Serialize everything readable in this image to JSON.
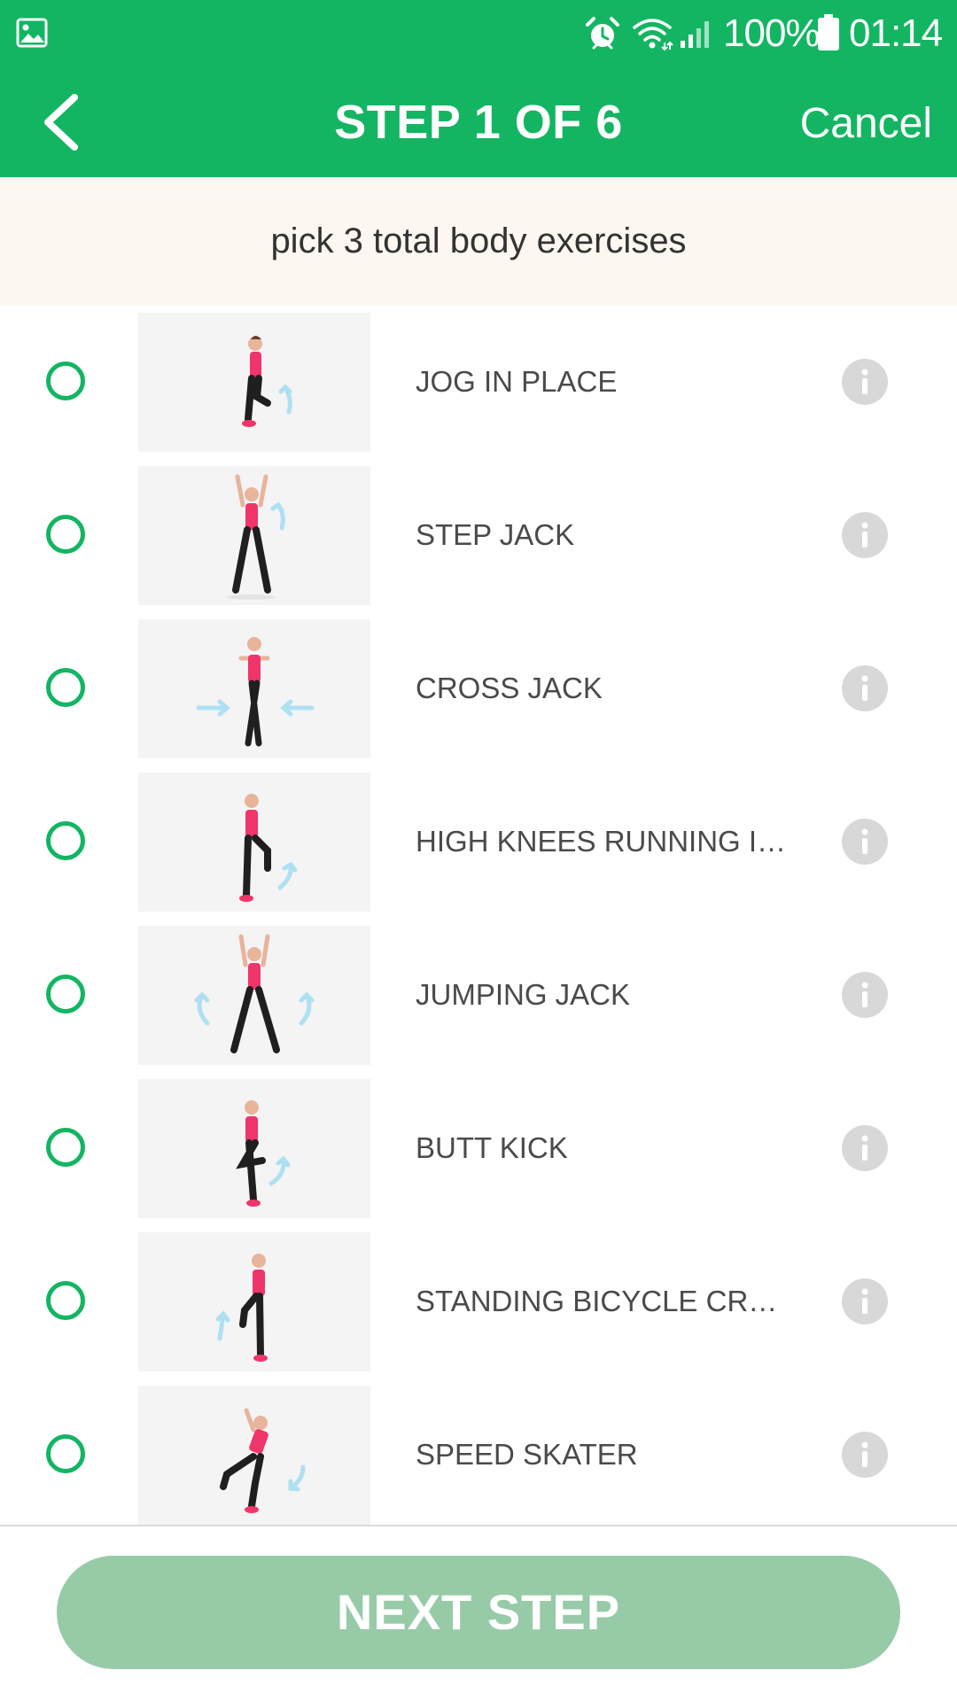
{
  "status_bar": {
    "battery_percent": "100%",
    "time": "01:14",
    "icons": [
      "gallery-icon",
      "alarm-icon",
      "wifi-icon",
      "signal-icon",
      "battery-icon"
    ]
  },
  "header": {
    "title": "STEP 1 OF 6",
    "cancel_label": "Cancel",
    "back_icon": "chevron-left-icon"
  },
  "instruction": "pick 3 total body exercises",
  "exercises": [
    {
      "name": "JOG IN PLACE",
      "selected": false
    },
    {
      "name": "STEP JACK",
      "selected": false
    },
    {
      "name": "CROSS JACK",
      "selected": false
    },
    {
      "name": "HIGH KNEES RUNNING IN...",
      "selected": false
    },
    {
      "name": "JUMPING JACK",
      "selected": false
    },
    {
      "name": "BUTT KICK",
      "selected": false
    },
    {
      "name": "STANDING BICYCLE CRUN...",
      "selected": false
    },
    {
      "name": "SPEED SKATER",
      "selected": false
    }
  ],
  "next_button": {
    "label": "NEXT STEP",
    "enabled": false
  },
  "colors": {
    "brand_green": "#13b562",
    "banner_bg": "#fcf8f1",
    "disabled_button": "#97cba8",
    "info_icon": "#d8d8d8",
    "figure_top": "#f0356b",
    "figure_pants": "#1f1f1f",
    "arrow": "#aee0f2"
  }
}
